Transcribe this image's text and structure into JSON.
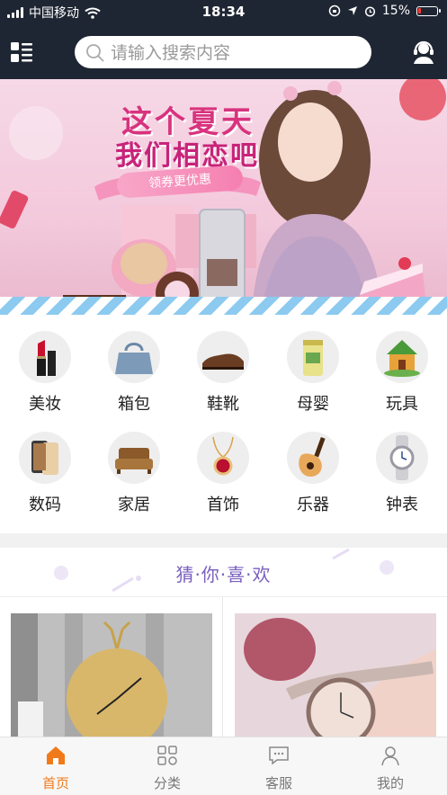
{
  "status_bar": {
    "carrier": "中国移动",
    "time": "18:34",
    "battery_text": "15%",
    "battery_level": 0.15
  },
  "header": {
    "search_placeholder": "请输入搜索内容",
    "menu_icon": "grid-list-icon",
    "service_icon": "headset-icon"
  },
  "banner": {
    "line1": "这个夏天",
    "line2": "我们相恋吧",
    "ribbon": "领券更优惠"
  },
  "categories": [
    {
      "label": "美妆",
      "icon": "lipstick-icon"
    },
    {
      "label": "箱包",
      "icon": "handbag-icon"
    },
    {
      "label": "鞋靴",
      "icon": "shoe-icon"
    },
    {
      "label": "母婴",
      "icon": "formula-can-icon"
    },
    {
      "label": "玩具",
      "icon": "toy-house-icon"
    },
    {
      "label": "数码",
      "icon": "phone-icon"
    },
    {
      "label": "家居",
      "icon": "sofa-icon"
    },
    {
      "label": "首饰",
      "icon": "pendant-icon"
    },
    {
      "label": "乐器",
      "icon": "guitar-icon"
    },
    {
      "label": "钟表",
      "icon": "watch-icon"
    }
  ],
  "section": {
    "guess_title": "猜·你·喜·欢"
  },
  "tabs": [
    {
      "label": "首页",
      "icon": "home-icon",
      "active": true
    },
    {
      "label": "分类",
      "icon": "category-icon",
      "active": false
    },
    {
      "label": "客服",
      "icon": "chat-icon",
      "active": false
    },
    {
      "label": "我的",
      "icon": "user-icon",
      "active": false
    }
  ],
  "colors": {
    "header_bg": "#1f2633",
    "accent": "#f07a1a",
    "guess_title": "#7a5fbf"
  }
}
